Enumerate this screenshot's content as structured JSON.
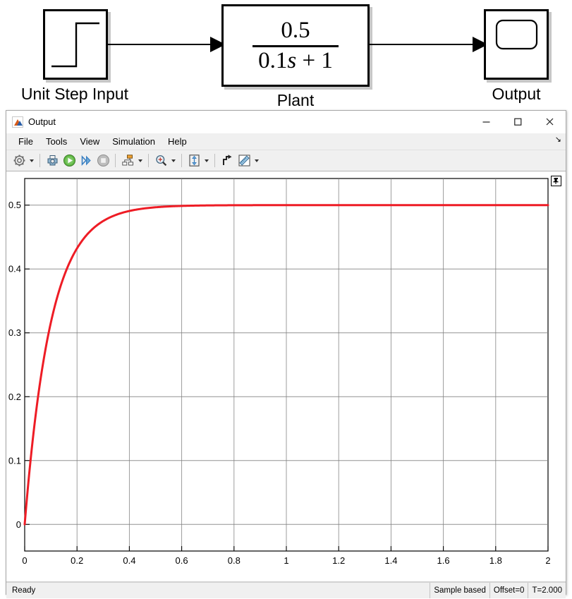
{
  "diagram": {
    "step_label": "Unit Step Input",
    "plant_label": "Plant",
    "output_label": "Output",
    "transfer_function": {
      "numerator": "0.5",
      "denominator_coeff": "0.1",
      "denominator_var": "s",
      "denominator_rest": "+ 1",
      "full": "0.5 / (0.1s + 1)"
    }
  },
  "window": {
    "title": "Output",
    "icon": "matlab-icon",
    "minimize_label": "—",
    "maximize_label": "□",
    "close_label": "✕"
  },
  "menu": {
    "items": [
      {
        "label": "File"
      },
      {
        "label": "Tools"
      },
      {
        "label": "View"
      },
      {
        "label": "Simulation"
      },
      {
        "label": "Help"
      }
    ],
    "overflow_glyph": "↘"
  },
  "toolbar": {
    "buttons": [
      {
        "name": "configuration-properties",
        "icon": "gear-icon",
        "caret": true
      },
      {
        "name": "print",
        "icon": "print-icon",
        "caret": false
      },
      {
        "name": "run",
        "icon": "play-icon",
        "caret": false
      },
      {
        "name": "step-forward",
        "icon": "step-forward-icon",
        "caret": false
      },
      {
        "name": "stop",
        "icon": "stop-icon",
        "caret": false
      },
      {
        "name": "signal-selection",
        "icon": "signal-selection-icon",
        "caret": true
      },
      {
        "name": "zoom",
        "icon": "zoom-in-icon",
        "caret": true
      },
      {
        "name": "autoscale",
        "icon": "autoscale-icon",
        "caret": true
      },
      {
        "name": "legend",
        "icon": "legend-icon",
        "caret": false
      },
      {
        "name": "measurements",
        "icon": "ruler-icon",
        "caret": true
      }
    ]
  },
  "plot": {
    "pin_icon": "pin-icon",
    "line_color": "#EE1C25",
    "grid_color": "#808080",
    "axis_color": "#000000",
    "background": "#FFFFFF"
  },
  "status": {
    "ready": "Ready",
    "sample_mode": "Sample based",
    "offset": "Offset=0",
    "time": "T=2.000"
  },
  "chart_data": {
    "type": "line",
    "title": "",
    "xlabel": "",
    "ylabel": "",
    "xlim": [
      0,
      2
    ],
    "ylim": [
      -0.0417,
      0.5417
    ],
    "xticks": [
      0,
      0.2,
      0.4,
      0.6,
      0.8,
      1,
      1.2,
      1.4,
      1.6,
      1.8,
      2
    ],
    "xticklabels": [
      "0",
      "0.2",
      "0.4",
      "0.6",
      "0.8",
      "1",
      "1.2",
      "1.4",
      "1.6",
      "1.8",
      "2"
    ],
    "yticks": [
      0,
      0.1,
      0.2,
      0.3,
      0.4,
      0.5
    ],
    "yticklabels": [
      "0",
      "0.1",
      "0.2",
      "0.3",
      "0.4",
      "0.5"
    ],
    "grid": true,
    "legend": false,
    "series": [
      {
        "name": "Output",
        "color": "#EE1C25",
        "formula": "y(t) = 0.5 * (1 - exp(-t/0.1))",
        "steady_state": 0.5,
        "time_constant": 0.1,
        "x": [
          0,
          0.02,
          0.04,
          0.06,
          0.08,
          0.1,
          0.12,
          0.14,
          0.16,
          0.18,
          0.2,
          0.25,
          0.3,
          0.35,
          0.4,
          0.45,
          0.5,
          0.6,
          0.7,
          0.8,
          0.9,
          1.0,
          1.2,
          1.4,
          1.6,
          1.8,
          2.0
        ],
        "y": [
          0,
          0.0906,
          0.1648,
          0.2256,
          0.2753,
          0.3161,
          0.3494,
          0.3768,
          0.3992,
          0.4174,
          0.4323,
          0.4589,
          0.4751,
          0.4849,
          0.4908,
          0.4944,
          0.4966,
          0.4988,
          0.4996,
          0.4998,
          0.4999,
          0.5,
          0.5,
          0.5,
          0.5,
          0.5,
          0.5
        ]
      }
    ]
  }
}
